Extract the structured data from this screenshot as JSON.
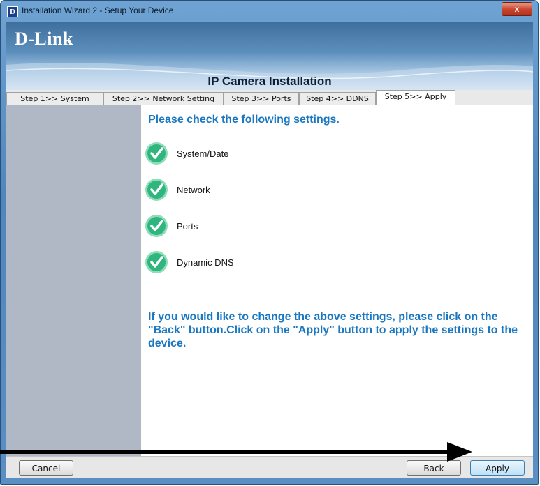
{
  "window": {
    "title": "Installation Wizard 2 - Setup Your Device",
    "close_glyph": "x"
  },
  "banner": {
    "logo": "D-Link",
    "title": "IP Camera Installation"
  },
  "tabs": [
    {
      "label": "Step 1>> System",
      "active": false
    },
    {
      "label": "Step 2>> Network Setting",
      "active": false
    },
    {
      "label": "Step 3>> Ports",
      "active": false
    },
    {
      "label": "Step 4>> DDNS",
      "active": false
    },
    {
      "label": "Step 5>> Apply",
      "active": true
    }
  ],
  "main": {
    "heading": "Please check the following settings.",
    "checks": [
      {
        "label": "System/Date",
        "icon": "check-circle-icon"
      },
      {
        "label": "Network",
        "icon": "check-circle-icon"
      },
      {
        "label": "Ports",
        "icon": "check-circle-icon"
      },
      {
        "label": "Dynamic DNS",
        "icon": "check-circle-icon"
      }
    ],
    "info": "If you would like to change the above settings, please click on the \"Back\" button.Click on the \"Apply\" button to apply the settings to the device."
  },
  "footer": {
    "cancel_label": "Cancel",
    "back_label": "Back",
    "apply_label": "Apply"
  },
  "colors": {
    "accent_text": "#1b78c0",
    "check_green": "#2fb57e",
    "left_pane": "#b0b8c6"
  }
}
